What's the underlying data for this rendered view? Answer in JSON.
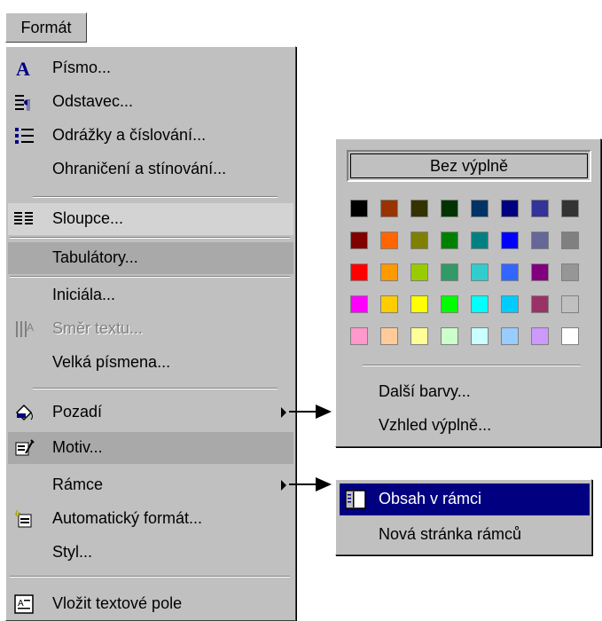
{
  "menu_button": "Formát",
  "menu": {
    "items": [
      {
        "label": "Písmo...",
        "icon": "font-icon"
      },
      {
        "label": "Odstavec...",
        "icon": "paragraph-icon"
      },
      {
        "label": "Odrážky a číslování...",
        "icon": "bullets-icon"
      },
      {
        "label": "Ohraničení a stínování...",
        "icon": ""
      },
      {
        "label": "Sloupce...",
        "icon": "columns-icon"
      },
      {
        "label": "Tabulátory...",
        "icon": ""
      },
      {
        "label": "Iniciála...",
        "icon": ""
      },
      {
        "label": "Směr textu...",
        "icon": "text-direction-icon"
      },
      {
        "label": "Velká písmena...",
        "icon": ""
      },
      {
        "label": "Pozadí",
        "icon": "paint-bucket-icon"
      },
      {
        "label": "Motiv...",
        "icon": "theme-icon"
      },
      {
        "label": "Rámce",
        "icon": ""
      },
      {
        "label": "Automatický formát...",
        "icon": "autoformat-icon"
      },
      {
        "label": "Styl...",
        "icon": ""
      },
      {
        "label": "Vložit textové pole",
        "icon": "text-box-icon"
      }
    ]
  },
  "color_panel": {
    "no_fill": "Bez výplně",
    "swatches": [
      [
        "#000000",
        "#993300",
        "#333300",
        "#003300",
        "#003366",
        "#000080",
        "#333399",
        "#333333"
      ],
      [
        "#800000",
        "#FF6600",
        "#808000",
        "#008000",
        "#008080",
        "#0000FF",
        "#666699",
        "#808080"
      ],
      [
        "#FF0000",
        "#FF9900",
        "#99CC00",
        "#339966",
        "#33CCCC",
        "#3366FF",
        "#800080",
        "#969696"
      ],
      [
        "#FF00FF",
        "#FFCC00",
        "#FFFF00",
        "#00FF00",
        "#00FFFF",
        "#00CCFF",
        "#993366",
        "#C0C0C0"
      ],
      [
        "#FF99CC",
        "#FFCC99",
        "#FFFF99",
        "#CCFFCC",
        "#CCFFFF",
        "#99CCFF",
        "#CC99FF",
        "#FFFFFF"
      ]
    ],
    "more_colors": "Další barvy...",
    "fill_effects": "Vzhled výplně..."
  },
  "frames_panel": {
    "items": [
      {
        "label": "Obsah v rámci",
        "icon": "frame-toc-icon"
      },
      {
        "label": "Nová stránka rámců",
        "icon": ""
      }
    ]
  }
}
